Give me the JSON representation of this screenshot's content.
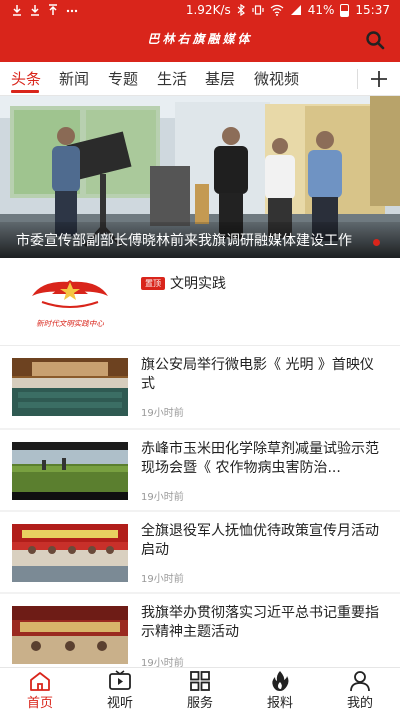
{
  "status_bar": {
    "left_icons": [
      "download-icon",
      "download-icon",
      "upload-icon",
      "more-icon"
    ],
    "speed": "1.92K/s",
    "battery": "41%",
    "time": "15:37"
  },
  "header": {
    "title": "巴林右旗融媒体"
  },
  "tabs": [
    {
      "label": "头条",
      "active": true
    },
    {
      "label": "新闻",
      "active": false
    },
    {
      "label": "专题",
      "active": false
    },
    {
      "label": "生活",
      "active": false
    },
    {
      "label": "基层",
      "active": false
    },
    {
      "label": "微视频",
      "active": false
    }
  ],
  "banner": {
    "caption": "市委宣传部副部长傅晓林前来我旗调研融媒体建设工作"
  },
  "promo": {
    "badge": "置顶",
    "title": "文明实践",
    "logo_text": "新时代文明实践中心"
  },
  "news": [
    {
      "title": "旗公安局举行微电影《 光明 》首映仪式",
      "time": "19小时前"
    },
    {
      "title": " 赤峰市玉米田化学除草剂减量试验示范现场会暨《 农作物病虫害防治...",
      "time": "19小时前"
    },
    {
      "title": "全旗退役军人抚恤优待政策宣传月活动启动",
      "time": "19小时前"
    },
    {
      "title": "我旗举办贯彻落实习近平总书记重要指示精神主题活动",
      "time": "19小时前"
    }
  ],
  "bottom_nav": [
    {
      "label": "首页",
      "icon": "home-icon",
      "active": true
    },
    {
      "label": "视听",
      "icon": "video-icon",
      "active": false
    },
    {
      "label": "服务",
      "icon": "grid-icon",
      "active": false
    },
    {
      "label": "报料",
      "icon": "flame-icon",
      "active": false
    },
    {
      "label": "我的",
      "icon": "user-icon",
      "active": false
    }
  ],
  "colors": {
    "brand_red": "#d9251b",
    "active_text": "#d9251b",
    "time_gray": "#999999"
  }
}
